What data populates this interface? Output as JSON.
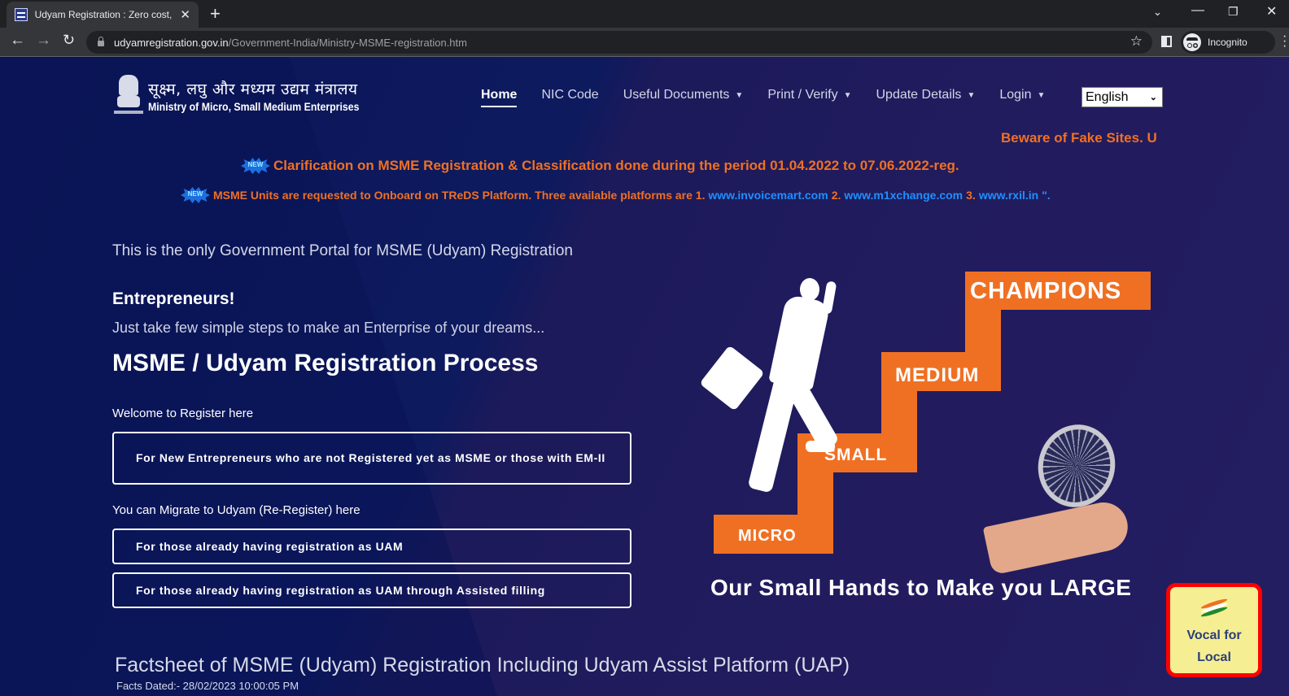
{
  "browser": {
    "tab_title": "Udyam Registration : Zero cost, MSME",
    "url_host": "udyamregistration.gov.in",
    "url_path": "/Government-India/Ministry-MSME-registration.htm",
    "profile_label": "Incognito"
  },
  "header": {
    "hindi_title": "सूक्ष्म, लघु और मध्यम उद्यम मंत्रालय",
    "english_title": "Ministry of Micro, Small Medium Enterprises",
    "nav": [
      {
        "label": "Home",
        "active": true,
        "dropdown": false
      },
      {
        "label": "NIC Code",
        "dropdown": false
      },
      {
        "label": "Useful Documents",
        "dropdown": true
      },
      {
        "label": "Print / Verify",
        "dropdown": true
      },
      {
        "label": "Update Details",
        "dropdown": true
      },
      {
        "label": "Login",
        "dropdown": true
      }
    ],
    "language": "English"
  },
  "marquee": "Beware of Fake Sites. U",
  "news": {
    "badge": "NEW",
    "item1": "Clarification on MSME Registration & Classification done during the period 01.04.2022 to 07.06.2022-reg.",
    "item2_prefix": "MSME Units are requested to Onboard on TReDS Platform. Three available platforms are 1.",
    "links": [
      "www.invoicemart.com",
      "www.m1xchange.com",
      "www.rxil.in"
    ],
    "sep2": "2.",
    "sep3": "3.",
    "suffix": "\"."
  },
  "main": {
    "intro": "This is the only Government Portal for MSME (Udyam) Registration",
    "entrepreneurs": "Entrepreneurs!",
    "subtitle": "Just take few simple steps to make an Enterprise of your dreams...",
    "process_title": "MSME / Udyam Registration Process",
    "register_label": "Welcome to Register here",
    "new_entrepreneurs_btn": "For New Entrepreneurs who are not Registered yet as MSME or those with EM-II",
    "migrate_label": "You can Migrate to Udyam (Re-Register) here",
    "uam_btn": "For those already having registration as UAM",
    "uam_assisted_btn": "For those already having registration as UAM through Assisted filling"
  },
  "hero": {
    "steps": [
      "MICRO",
      "SMALL",
      "MEDIUM",
      "CHAMPIONS"
    ],
    "tagline": "Our Small Hands to Make you LARGE"
  },
  "vocal": {
    "line1": "Vocal for",
    "line2": "Local"
  },
  "factsheet": {
    "title": "Factsheet of MSME (Udyam) Registration Including Udyam Assist Platform (UAP)",
    "dated": "Facts Dated:- 28/02/2023 10:00:05 PM"
  },
  "colors": {
    "accent_orange": "#f07023",
    "link_blue": "#1e90ff",
    "bg_navy": "#1c1a5a"
  }
}
